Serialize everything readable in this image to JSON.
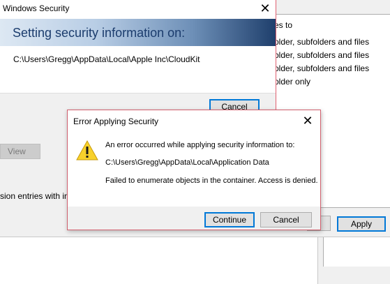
{
  "background_window": {
    "list_rows": [
      "es to",
      "older, subfolders and files",
      "older, subfolders and files",
      "older, subfolders and files",
      "older only"
    ],
    "view_button": "View",
    "permission_entries_text": "sion entries with in",
    "apply_button": "Apply"
  },
  "windows_security": {
    "title": "Windows Security",
    "banner_text": "Setting security information on:",
    "path": "C:\\Users\\Gregg\\AppData\\Local\\Apple Inc\\CloudKit",
    "cancel_button": "Cancel",
    "close_glyph": "✕"
  },
  "error_dialog": {
    "title": "Error Applying Security",
    "close_glyph": "✕",
    "icon": "warning-icon",
    "message_line1": "An error occurred while applying security information to:",
    "message_path": "C:\\Users\\Gregg\\AppData\\Local\\Application Data",
    "message_line3": "Failed to enumerate objects in the container. Access is denied.",
    "continue_button": "Continue",
    "cancel_button": "Cancel"
  },
  "colors": {
    "accent_border": "#0078d7",
    "dialog_border": "#d0606e",
    "warning_yellow": "#f8d12b",
    "banner_text": "#1b3c6d"
  }
}
